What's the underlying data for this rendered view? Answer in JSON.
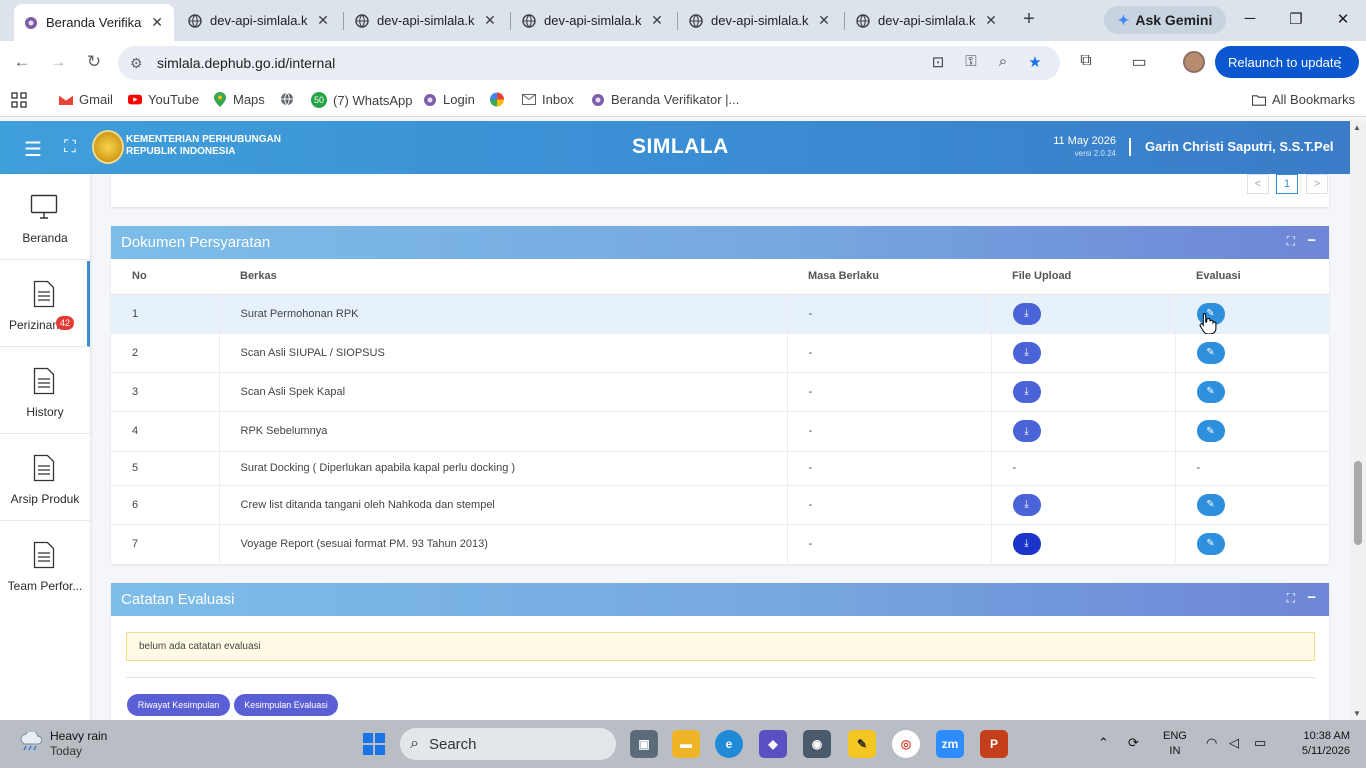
{
  "browser": {
    "tabs": [
      {
        "title": "Beranda Verifikato",
        "active": true
      },
      {
        "title": "dev-api-simlala.ke",
        "active": false
      },
      {
        "title": "dev-api-simlala.ke",
        "active": false
      },
      {
        "title": "dev-api-simlala.ke",
        "active": false
      },
      {
        "title": "dev-api-simlala.ke",
        "active": false
      },
      {
        "title": "dev-api-simlala.ke",
        "active": false
      }
    ],
    "ask_gemini": "Ask Gemini",
    "url": "simlala.dephub.go.id/internal",
    "relaunch": "Relaunch to update",
    "bookmarks": [
      {
        "label": "Gmail",
        "icon": "gmail-icon"
      },
      {
        "label": "YouTube",
        "icon": "youtube-icon"
      },
      {
        "label": "Maps",
        "icon": "maps-icon"
      },
      {
        "label": "",
        "icon": "globe-icon"
      },
      {
        "label": "(7) WhatsApp",
        "icon": "whatsapp-icon",
        "badge": "50"
      },
      {
        "label": "Login",
        "icon": "login-icon"
      },
      {
        "label": "",
        "icon": "pinwheel-icon"
      },
      {
        "label": "Inbox",
        "icon": "inbox-icon"
      },
      {
        "label": "Beranda Verifikator |...",
        "icon": "site-icon"
      }
    ],
    "all_bookmarks": "All Bookmarks"
  },
  "header": {
    "ministry_line1": "KEMENTERIAN PERHUBUNGAN",
    "ministry_line2": "REPUBLIK INDONESIA",
    "app_name": "SIMLALA",
    "date": "11 May 2026",
    "version": "versi 2.0.24",
    "user": "Garin Christi Saputri, S.S.T.Pel"
  },
  "sidebar": {
    "items": [
      {
        "label": "Beranda",
        "icon": "monitor-icon"
      },
      {
        "label": "Perizinan",
        "icon": "document-icon",
        "badge": "42"
      },
      {
        "label": "History",
        "icon": "document-icon"
      },
      {
        "label": "Arsip Produk",
        "icon": "document-icon"
      },
      {
        "label": "Team Perfor...",
        "icon": "document-icon"
      }
    ]
  },
  "pager": {
    "prev": "<",
    "current": "1",
    "next": ">"
  },
  "dokumen": {
    "title": "Dokumen Persyaratan",
    "columns": [
      "No",
      "Berkas",
      "Masa Berlaku",
      "File Upload",
      "Evaluasi"
    ],
    "rows": [
      {
        "no": "1",
        "berkas": "Surat Permohonan RPK",
        "masa": "-",
        "upload": true,
        "eval": true
      },
      {
        "no": "2",
        "berkas": "Scan Asli SIUPAL / SIOPSUS",
        "masa": "-",
        "upload": true,
        "eval": true
      },
      {
        "no": "3",
        "berkas": "Scan Asli Spek Kapal",
        "masa": "-",
        "upload": true,
        "eval": true
      },
      {
        "no": "4",
        "berkas": "RPK Sebelumnya",
        "masa": "-",
        "upload": true,
        "eval": true
      },
      {
        "no": "5",
        "berkas": "Surat Docking ( Diperlukan apabila kapal perlu docking )",
        "masa": "-",
        "upload": false,
        "upload_text": "-",
        "eval": false,
        "eval_text": "-"
      },
      {
        "no": "6",
        "berkas": "Crew list ditanda tangani oleh Nahkoda dan stempel",
        "masa": "-",
        "upload": true,
        "eval": true
      },
      {
        "no": "7",
        "berkas": "Voyage Report (sesuai format PM. 93 Tahun 2013)",
        "masa": "-",
        "upload": true,
        "eval": true
      }
    ]
  },
  "catatan": {
    "title": "Catatan Evaluasi",
    "empty_note": "belum ada catatan evaluasi",
    "btn_riwayat": "Riwayat Kesimpulan",
    "btn_kesimpulan": "Kesimpulan Evaluasi"
  },
  "taskbar": {
    "weather_title": "Heavy rain",
    "weather_sub": "Today",
    "search_placeholder": "Search",
    "lang_1": "ENG",
    "lang_2": "IN",
    "time": "10:38 AM",
    "date": "5/11/2026"
  }
}
